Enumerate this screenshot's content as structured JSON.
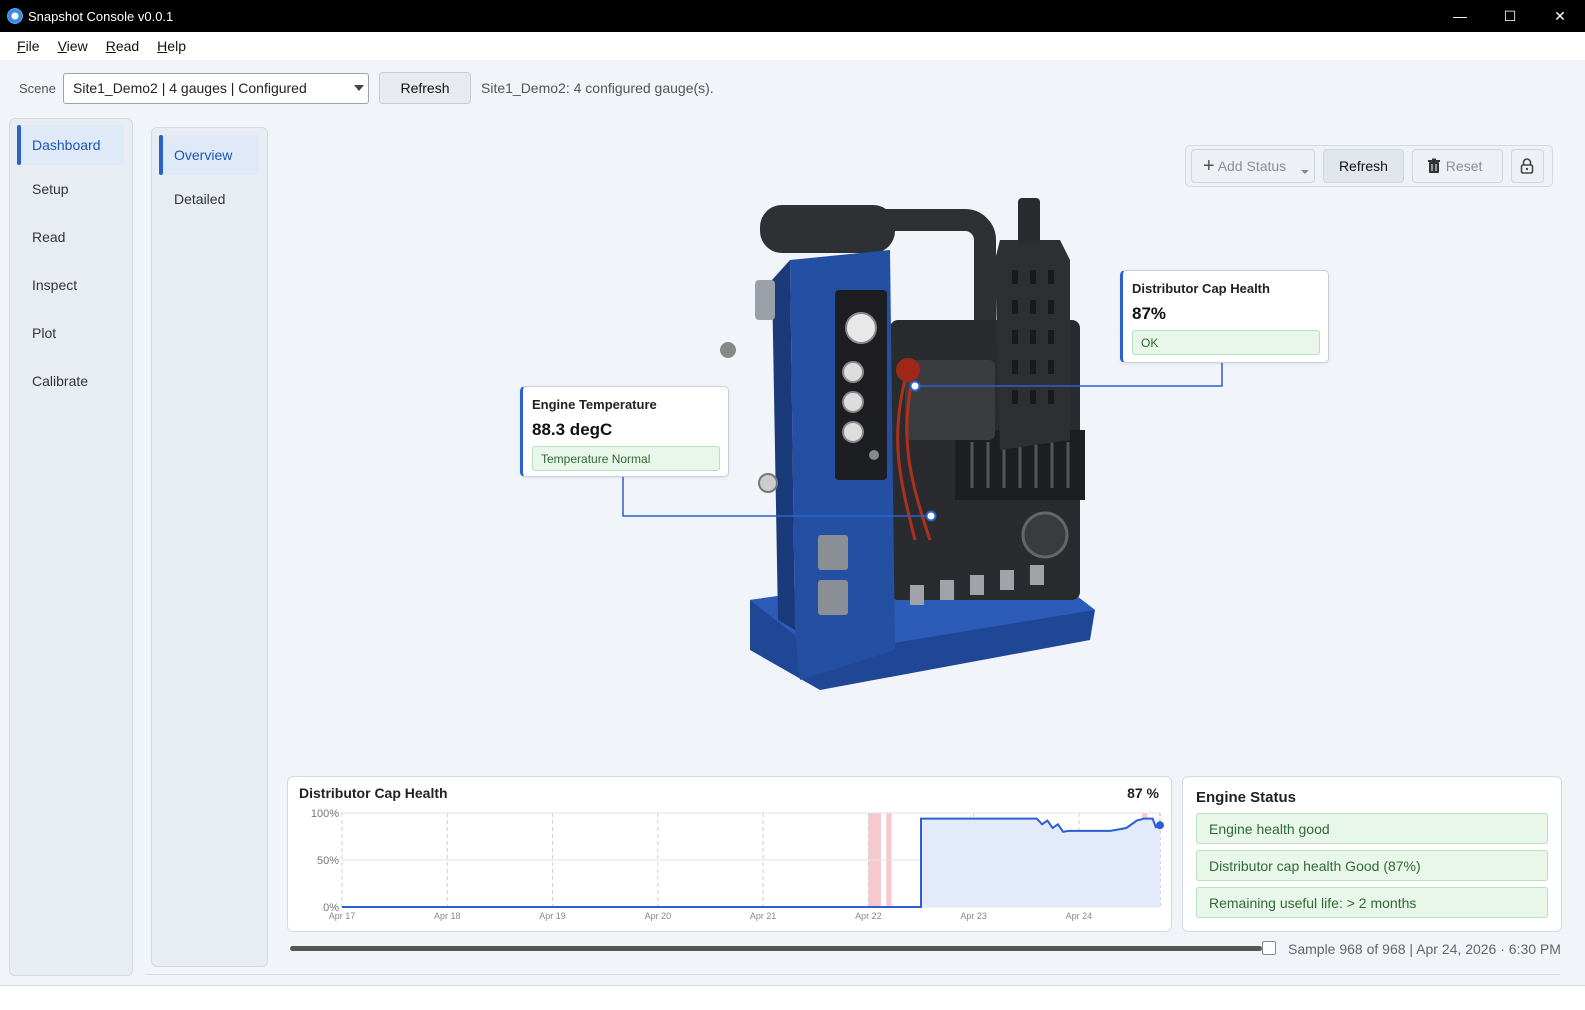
{
  "window": {
    "title": "Snapshot Console v0.0.1",
    "controls": {
      "minimize": "—",
      "maximize": "☐",
      "close": "✕"
    }
  },
  "menu": [
    {
      "first": "F",
      "rest": "ile"
    },
    {
      "first": "V",
      "rest": "iew"
    },
    {
      "first": "R",
      "rest": "ead"
    },
    {
      "first": "H",
      "rest": "elp"
    }
  ],
  "scene": {
    "label": "Scene",
    "selected": "Site1_Demo2 | 4 gauges | Configured",
    "refresh_label": "Refresh",
    "status": "Site1_Demo2: 4 configured gauge(s)."
  },
  "nav": {
    "items": [
      "Dashboard",
      "Setup",
      "Read",
      "Inspect",
      "Plot",
      "Calibrate"
    ],
    "active": "Dashboard"
  },
  "subnav": {
    "items": [
      "Overview",
      "Detailed"
    ],
    "active": "Overview"
  },
  "toolbar": {
    "add_status": "Add Status",
    "refresh": "Refresh",
    "reset": "Reset"
  },
  "callouts": {
    "distributor": {
      "title": "Distributor Cap Health",
      "value": "87%",
      "status": "OK"
    },
    "engine_temp": {
      "title": "Engine Temperature",
      "value": "88.3 degC",
      "status": "Temperature Normal"
    }
  },
  "chart_data": {
    "type": "area",
    "title": "Distributor Cap Health",
    "current_label": "87 %",
    "ylabel": "",
    "xlabel": "",
    "ylim": [
      0,
      100
    ],
    "y_ticks": [
      "0%",
      "50%",
      "100%"
    ],
    "x_ticks": [
      "Apr 17",
      "Apr 18",
      "Apr 19",
      "Apr 20",
      "Apr 21",
      "Apr 22",
      "Apr 23",
      "Apr 24"
    ],
    "x_range": [
      "Apr 17",
      "Apr 24 ~18:30"
    ],
    "series": [
      {
        "x_days": [
          0,
          5.0,
          5.5,
          5.5,
          6.6,
          6.65,
          6.7,
          6.75,
          6.8,
          6.85,
          6.9,
          7.0,
          7.3,
          7.45,
          7.55,
          7.62,
          7.7,
          7.73,
          7.77
        ],
        "values": [
          0,
          0,
          0,
          94,
          94,
          88,
          92,
          84,
          88,
          80,
          81,
          81,
          81,
          84,
          92,
          94,
          94,
          85,
          87
        ]
      }
    ],
    "alarm_bands_days": [
      5.0,
      5.12,
      5.17,
      5.22,
      7.6,
      7.65,
      5.0
    ],
    "grid": true
  },
  "engine_status": {
    "title": "Engine Status",
    "items": [
      "Engine health good",
      "Distributor cap health Good (87%)",
      "Remaining useful life: > 2 months"
    ]
  },
  "timeline": {
    "sample_text": "Sample 968 of 968 | Apr 24, 2026 · 6:30 PM",
    "position": 1.0
  },
  "colors": {
    "accent": "#2a62c9",
    "ok_bg": "#e9f6ea",
    "ok_text": "#2f6b35",
    "chart_line": "#2a5fd6",
    "chart_fill": "#e3ebfa",
    "alarm_band": "#f6c9cc",
    "machine_blue": "#2450a3"
  }
}
